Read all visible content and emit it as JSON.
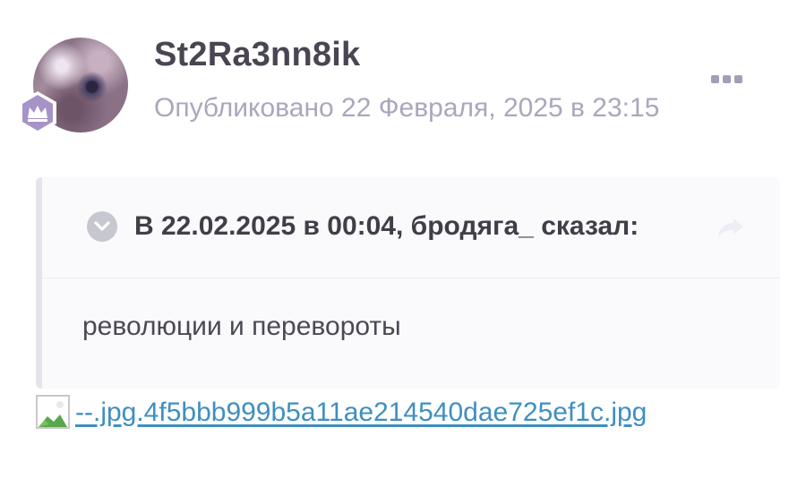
{
  "post": {
    "author": {
      "username": "St2Ra3nn8ik",
      "avatar": "avatar-image",
      "badge": "crown-badge-icon"
    },
    "published_text": "Опубликовано 22 Февраля, 2025 в 23:15",
    "menu_icon": "more-dots-icon"
  },
  "quote": {
    "title": "В 22.02.2025 в 00:04, бродяга_ сказал:",
    "toggle_icon": "chevron-down-icon",
    "share_icon": "share-arrow-icon",
    "body": "революции и перевороты"
  },
  "attachment": {
    "icon": "broken-image-icon",
    "link_text": "--.jpg.4f5bbb999b5a11ae214540dae725ef1c.jpg"
  },
  "colors": {
    "accent_link": "#3f8fc0",
    "badge": "#a693c7",
    "muted_text": "#a8a8bd"
  }
}
